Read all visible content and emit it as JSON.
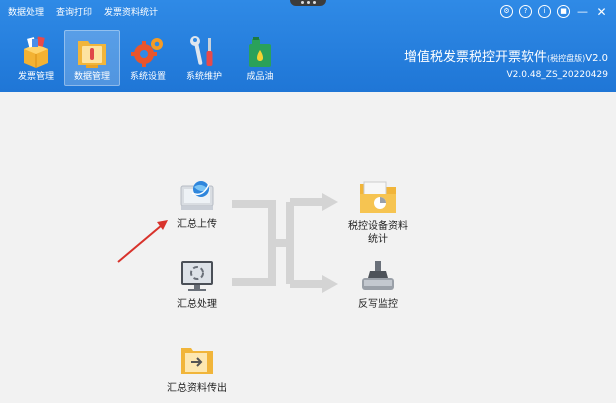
{
  "menu": [
    "数据处理",
    "查询打印",
    "发票资料统计"
  ],
  "window_controls": [
    "settings-icon",
    "help-icon",
    "info-icon",
    "lock-icon",
    "minimize-icon",
    "close-icon"
  ],
  "toolbar": [
    {
      "label": "发票管理",
      "icon": "invoice-box-icon"
    },
    {
      "label": "数据管理",
      "icon": "data-folder-icon",
      "active": true
    },
    {
      "label": "系统设置",
      "icon": "gears-icon"
    },
    {
      "label": "系统维护",
      "icon": "wrench-screwdriver-icon"
    },
    {
      "label": "成品油",
      "icon": "oil-can-icon"
    }
  ],
  "brand": {
    "title": "增值税发票税控开票软件",
    "edition": "(税控盘版)",
    "edition_version": "V2.0",
    "version": "V2.0.48_ZS_20220429"
  },
  "actions": {
    "upload": "汇总上传",
    "process": "汇总处理",
    "export": "汇总资料传出",
    "device_stats_line1": "税控设备资料",
    "device_stats_line2": "统计",
    "reverse_monitor": "反写监控"
  },
  "colors": {
    "topbar": "#1f76d6",
    "arrow": "#d8322b",
    "flow": "#d0d0d0"
  }
}
